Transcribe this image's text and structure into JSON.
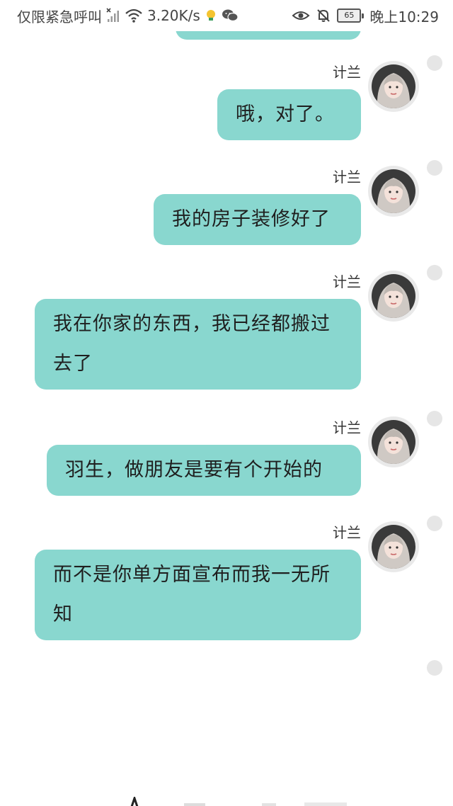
{
  "status_bar": {
    "carrier": "仅限紧急呼叫",
    "net_speed": "3.20K/s",
    "battery": "65",
    "time": "晚上10:29",
    "icons": [
      "no-signal-icon",
      "wifi-icon",
      "tips-icon",
      "wechat-icon",
      "eye-icon",
      "mute-bell-icon",
      "battery-icon"
    ]
  },
  "colors": {
    "bubble": "#89d7cf",
    "background": "#ffffff",
    "select_dot": "#e6e6e6"
  },
  "messages": [
    {
      "sender": "计兰",
      "text": "哦，对了。"
    },
    {
      "sender": "计兰",
      "text": "我的房子装修好了"
    },
    {
      "sender": "计兰",
      "text": "我在你家的东西，我已经都搬过去了"
    },
    {
      "sender": "计兰",
      "text": "羽生，做朋友是要有个开始的"
    },
    {
      "sender": "计兰",
      "text": "而不是你单方面宣布而我一无所知"
    }
  ]
}
